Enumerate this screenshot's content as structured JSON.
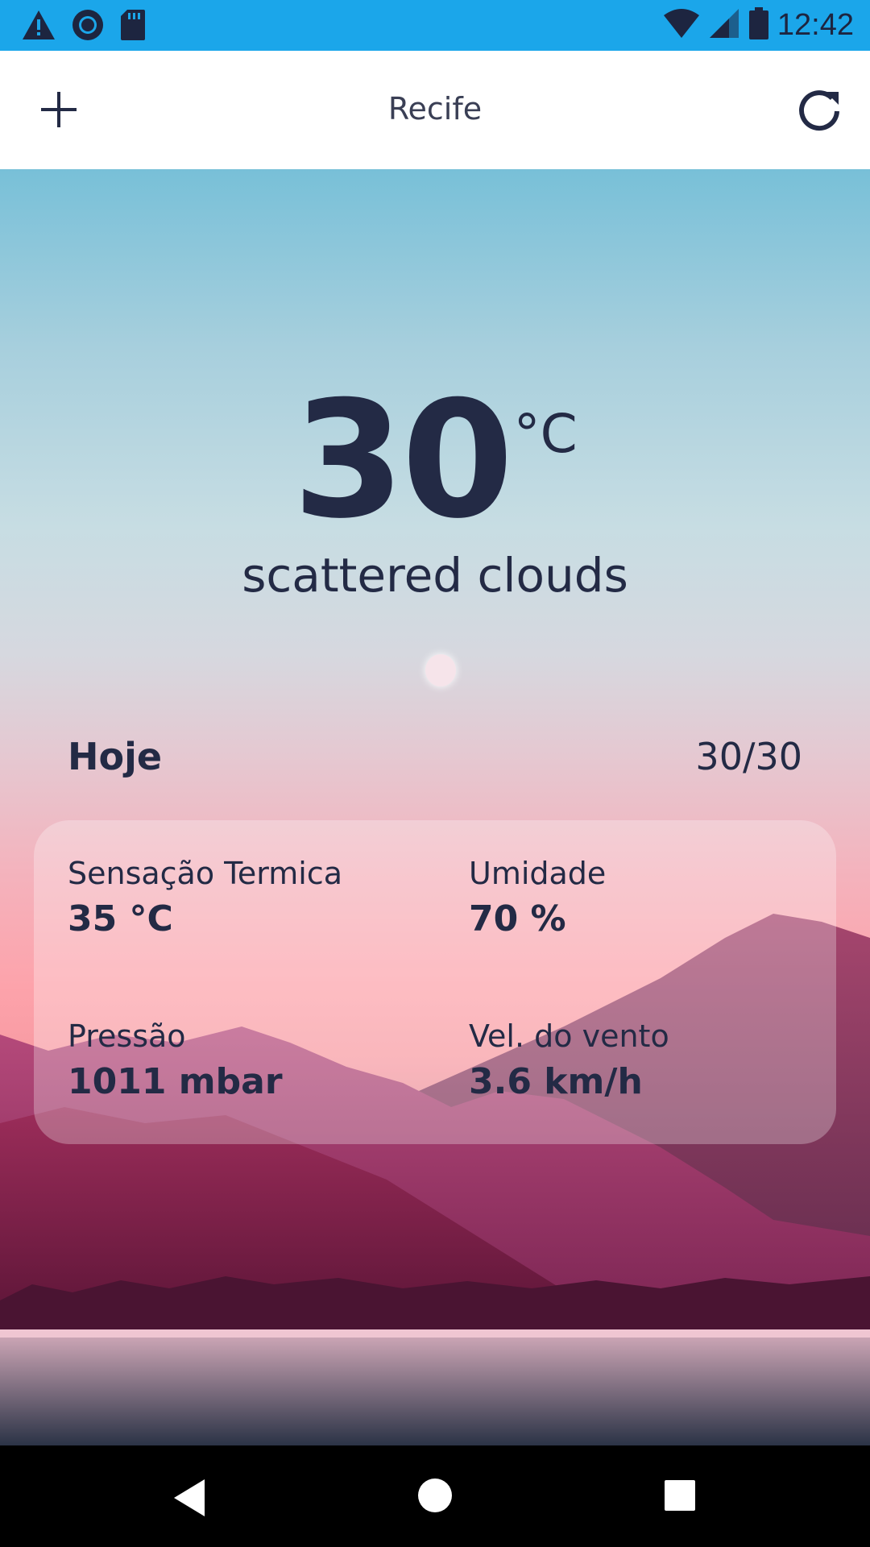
{
  "status_bar": {
    "time": "12:42",
    "left_icons": [
      "warning-icon",
      "circle-notification-icon",
      "sd-card-icon"
    ],
    "right_icons": [
      "wifi-icon",
      "signal-icon",
      "battery-icon"
    ],
    "background": "#1ba6ea"
  },
  "app_bar": {
    "title": "Recife",
    "add_icon": "plus-icon",
    "refresh_icon": "refresh-icon"
  },
  "weather": {
    "temperature": "30",
    "unit": "°C",
    "description": "scattered clouds"
  },
  "today": {
    "label": "Hoje",
    "range": "30/30"
  },
  "details": {
    "feels_like_label": "Sensação Termica",
    "feels_like_value": "35 °C",
    "humidity_label": "Umidade",
    "humidity_value": "70 %",
    "pressure_label": "Pressão",
    "pressure_value": "1011 mbar",
    "wind_label": "Vel. do vento",
    "wind_value": "3.6 km/h"
  },
  "nav_bar": {
    "icons": [
      "back-icon",
      "home-icon",
      "recents-icon"
    ]
  },
  "colors": {
    "text": "#232a45",
    "accent": "#1ba6ea"
  }
}
